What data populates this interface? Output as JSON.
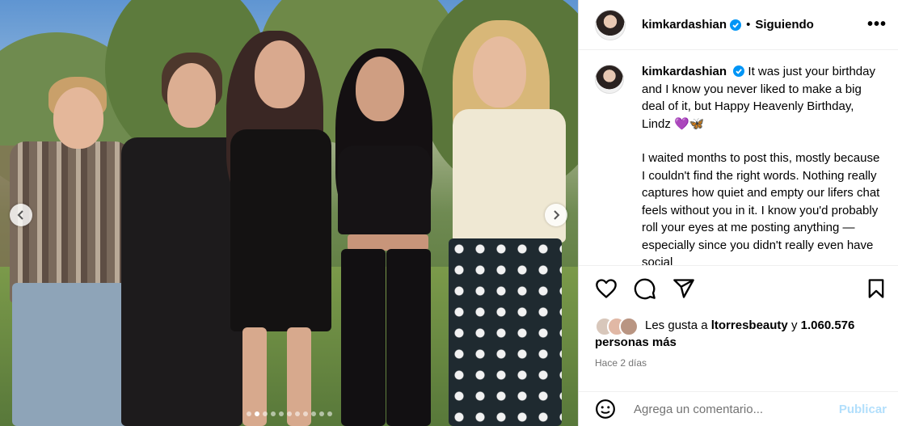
{
  "post": {
    "username": "kimkardashian",
    "separator": "•",
    "follow_status": "Siguiendo",
    "more_label": "•••",
    "caption_paragraph_1": "It was just your birthday and I know you never liked to make a big deal of it, but Happy Heavenly Birthday, Lindz 💜🦋",
    "caption_paragraph_2": "I waited months to post this, mostly because I couldn't find the right words. Nothing really captures how quiet and empty our lifers chat feels without you in it. I know you'd probably roll your eyes at me posting anything — especially since you didn't really even have social",
    "likes_prefix": "Les gusta a ",
    "likes_user": "ltorresbeauty",
    "likes_middle": " y ",
    "likes_count": "1.060.576",
    "likes_suffix": "personas más",
    "timestamp": "Hace 2 días",
    "comment_placeholder": "Agrega un comentario...",
    "publish_label": "Publicar"
  },
  "carousel": {
    "total_slides": 11,
    "active_index": 1
  },
  "colors": {
    "verified": "#0095f6",
    "publish_disabled": "#b2dffc",
    "meta_gray": "#737373"
  },
  "icons": [
    "heart-icon",
    "comment-icon",
    "share-icon",
    "bookmark-icon",
    "emoji-icon",
    "chevron-left-icon",
    "chevron-right-icon",
    "verified-badge-icon",
    "more-options-icon"
  ]
}
